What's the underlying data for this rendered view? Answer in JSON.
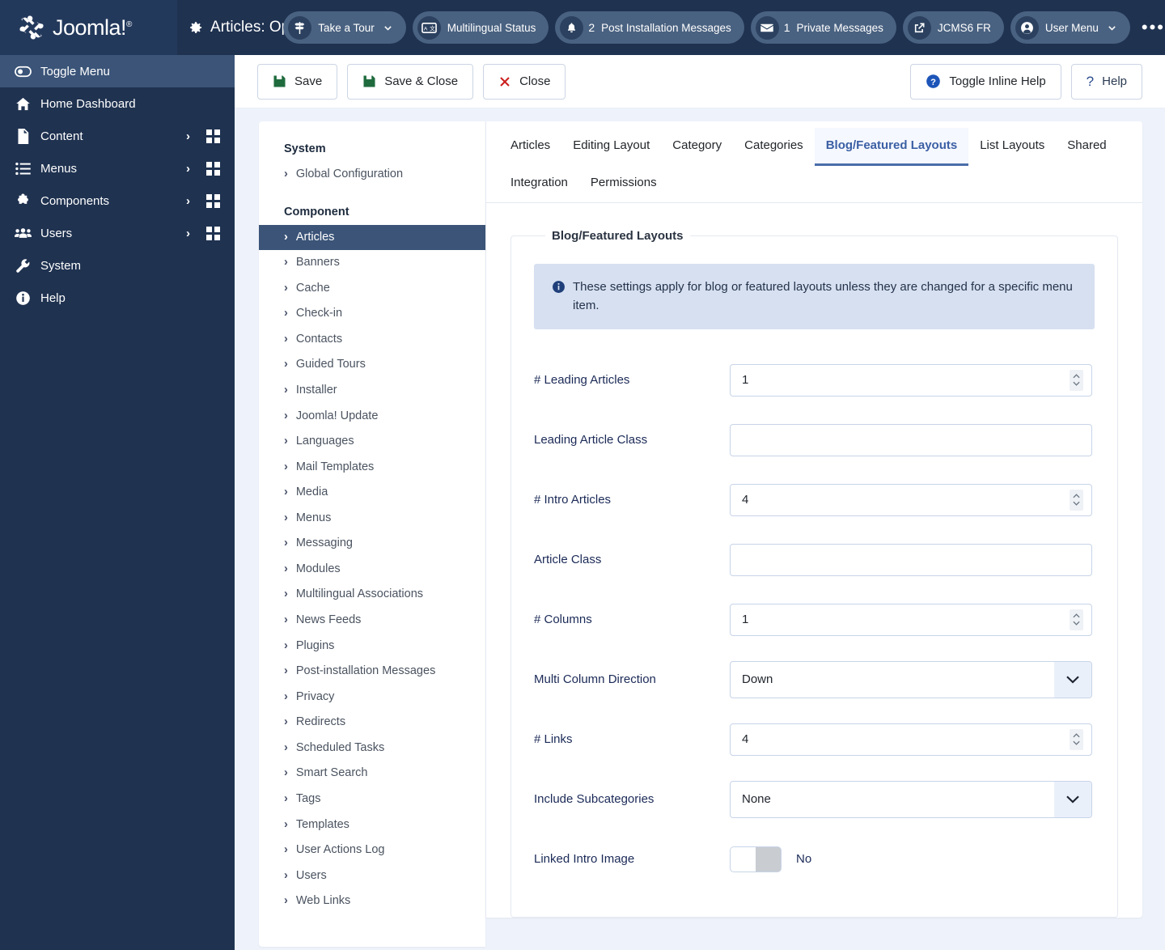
{
  "header": {
    "brand": "Joomla!",
    "page_title": "Articles: Op",
    "pills": [
      {
        "label": "Take a Tour",
        "icon": "signpost-icon",
        "count": "",
        "chevron": true
      },
      {
        "label": "Multilingual Status",
        "icon": "translate-icon",
        "count": "",
        "chevron": false
      },
      {
        "label": "Post Installation Messages",
        "icon": "bell-icon",
        "count": "2",
        "chevron": false
      },
      {
        "label": "Private Messages",
        "icon": "envelope-icon",
        "count": "1",
        "chevron": false
      },
      {
        "label": "JCMS6 FR",
        "icon": "external-link-icon",
        "count": "",
        "chevron": false
      },
      {
        "label": "User Menu",
        "icon": "user-icon",
        "count": "",
        "chevron": true
      }
    ],
    "overflow": "•••"
  },
  "sidebar": {
    "toggle_label": "Toggle Menu",
    "items": [
      {
        "label": "Home Dashboard",
        "icon": "home-icon",
        "arrow": false,
        "grid": false
      },
      {
        "label": "Content",
        "icon": "document-icon",
        "arrow": true,
        "grid": true
      },
      {
        "label": "Menus",
        "icon": "list-icon",
        "arrow": true,
        "grid": true
      },
      {
        "label": "Components",
        "icon": "puzzle-icon",
        "arrow": true,
        "grid": true
      },
      {
        "label": "Users",
        "icon": "users-icon",
        "arrow": true,
        "grid": true
      },
      {
        "label": "System",
        "icon": "wrench-icon",
        "arrow": false,
        "grid": false
      },
      {
        "label": "Help",
        "icon": "info-icon",
        "arrow": false,
        "grid": false
      }
    ]
  },
  "toolbar": {
    "save": "Save",
    "save_close": "Save & Close",
    "close": "Close",
    "toggle_inline_help": "Toggle Inline Help",
    "help": "Help"
  },
  "nav_panel": {
    "system_heading": "System",
    "system_items": [
      "Global Configuration"
    ],
    "component_heading": "Component",
    "component_items": [
      "Articles",
      "Banners",
      "Cache",
      "Check-in",
      "Contacts",
      "Guided Tours",
      "Installer",
      "Joomla! Update",
      "Languages",
      "Mail Templates",
      "Media",
      "Menus",
      "Messaging",
      "Modules",
      "Multilingual Associations",
      "News Feeds",
      "Plugins",
      "Post-installation Messages",
      "Privacy",
      "Redirects",
      "Scheduled Tasks",
      "Smart Search",
      "Tags",
      "Templates",
      "User Actions Log",
      "Users",
      "Web Links"
    ],
    "active_item": "Articles"
  },
  "tabs": [
    {
      "label": "Articles",
      "active": false
    },
    {
      "label": "Editing Layout",
      "active": false
    },
    {
      "label": "Category",
      "active": false
    },
    {
      "label": "Categories",
      "active": false
    },
    {
      "label": "Blog/Featured Layouts",
      "active": true
    },
    {
      "label": "List Layouts",
      "active": false
    },
    {
      "label": "Shared",
      "active": false
    },
    {
      "label": "Integration",
      "active": false
    },
    {
      "label": "Permissions",
      "active": false
    }
  ],
  "panel": {
    "legend": "Blog/Featured Layouts",
    "alert": "These settings apply for blog or featured layouts unless they are changed for a specific menu item.",
    "fields": [
      {
        "label": "# Leading Articles",
        "type": "number",
        "value": "1"
      },
      {
        "label": "Leading Article Class",
        "type": "text",
        "value": ""
      },
      {
        "label": "# Intro Articles",
        "type": "number",
        "value": "4"
      },
      {
        "label": "Article Class",
        "type": "text",
        "value": ""
      },
      {
        "label": "# Columns",
        "type": "number",
        "value": "1"
      },
      {
        "label": "Multi Column Direction",
        "type": "select",
        "value": "Down"
      },
      {
        "label": "# Links",
        "type": "number",
        "value": "4"
      },
      {
        "label": "Include Subcategories",
        "type": "select",
        "value": "None"
      },
      {
        "label": "Linked Intro Image",
        "type": "switch",
        "value": "No"
      }
    ]
  },
  "colors": {
    "header_bg": "#1f3250",
    "sidebar_bg": "#1f3250",
    "accent": "#3b5fa4",
    "active_item_bg": "#3b5478",
    "page_bg": "#eef2fb",
    "save_icon": "#1f6b3d",
    "close_icon": "#cc1f1f"
  }
}
